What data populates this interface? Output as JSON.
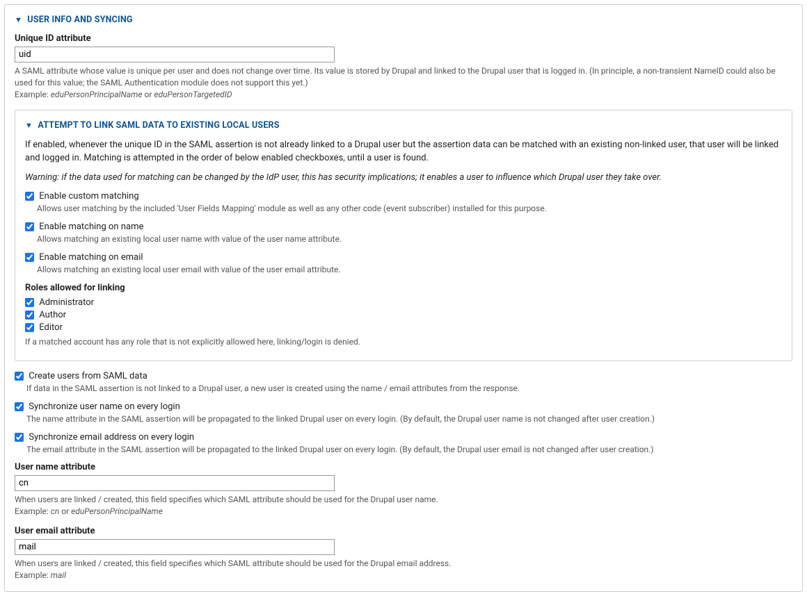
{
  "outer": {
    "title": "USER INFO AND SYNCING",
    "uid": {
      "label": "Unique ID attribute",
      "value": "uid",
      "desc": "A SAML attribute whose value is unique per user and does not change over time. Its value is stored by Drupal and linked to the Drupal user that is logged in. (In principle, a non-transient NameID could also be used for this value; the SAML Authentication module does not support this yet.)",
      "example_prefix": "Example: ",
      "example_em1": "eduPersonPrincipalName",
      "example_or": " or ",
      "example_em2": "eduPersonTargetedID"
    }
  },
  "link": {
    "title": "ATTEMPT TO LINK SAML DATA TO EXISTING LOCAL USERS",
    "intro": "If enabled, whenever the unique ID in the SAML assertion is not already linked to a Drupal user but the assertion data can be matched with an existing non-linked user, that user will be linked and logged in. Matching is attempted in the order of below enabled checkboxes, until a user is found.",
    "warning": "Warning: if the data used for matching can be changed by the IdP user, this has security implications; it enables a user to influence which Drupal user they take over.",
    "custom": {
      "label": "Enable custom matching",
      "desc": "Allows user matching by the included 'User Fields Mapping' module as well as any other code (event subscriber) installed for this purpose."
    },
    "name": {
      "label": "Enable matching on name",
      "desc": "Allows matching an existing local user name with value of the user name attribute."
    },
    "email": {
      "label": "Enable matching on email",
      "desc": "Allows matching an existing local user email with value of the user email attribute."
    },
    "roles": {
      "title": "Roles allowed for linking",
      "items": [
        "Administrator",
        "Author",
        "Editor"
      ],
      "desc": "If a matched account has any role that is not explicitly allowed here, linking/login is denied."
    }
  },
  "create": {
    "label": "Create users from SAML data",
    "desc": "If data in the SAML assertion is not linked to a Drupal user, a new user is created using the name / email attributes from the response."
  },
  "syncname": {
    "label": "Synchronize user name on every login",
    "desc": "The name attribute in the SAML assertion will be propagated to the linked Drupal user on every login. (By default, the Drupal user name is not changed after user creation.)"
  },
  "syncemail": {
    "label": "Synchronize email address on every login",
    "desc": "The email attribute in the SAML assertion will be propagated to the linked Drupal user on every login. (By default, the Drupal user email is not changed after user creation.)"
  },
  "uname": {
    "label": "User name attribute",
    "value": "cn",
    "desc": "When users are linked / created, this field specifies which SAML attribute should be used for the Drupal user name.",
    "example_prefix": "Example: ",
    "example_em1": "cn",
    "example_or": " or ",
    "example_em2": "eduPersonPrincipalName"
  },
  "uemail": {
    "label": "User email attribute",
    "value": "mail",
    "desc": "When users are linked / created, this field specifies which SAML attribute should be used for the Drupal email address.",
    "example_prefix": "Example: ",
    "example_em1": "mail"
  }
}
